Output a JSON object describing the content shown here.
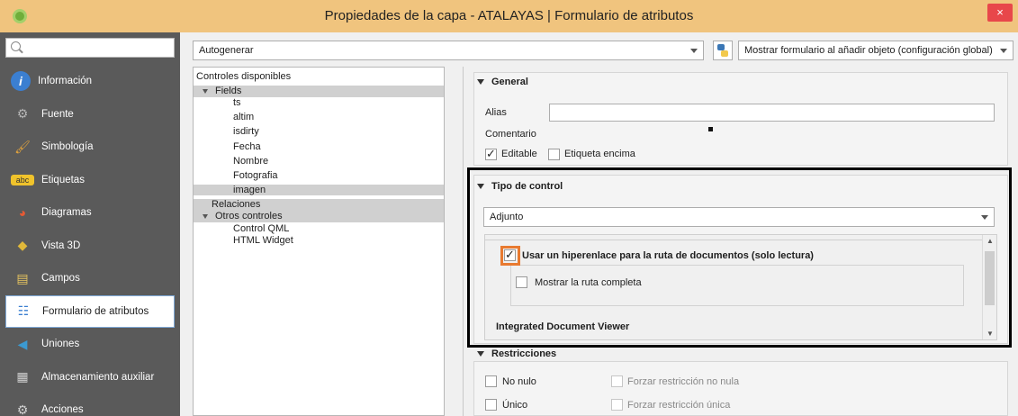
{
  "window": {
    "title": "Propiedades de la capa - ATALAYAS | Formulario de atributos",
    "close_label": "×"
  },
  "sidebar": {
    "search_placeholder": "",
    "items": [
      {
        "label": "Información",
        "icon": "info-icon",
        "icon_char": "i",
        "icon_color": "#3b7fd1"
      },
      {
        "label": "Fuente",
        "icon": "source-icon",
        "icon_char": "⚙",
        "icon_color": "#b5b5b5"
      },
      {
        "label": "Simbología",
        "icon": "symbology-icon",
        "icon_char": "🖌",
        "icon_color": "#e2a33c"
      },
      {
        "label": "Etiquetas",
        "icon": "labels-icon",
        "icon_char": "abc",
        "icon_color": "#f0c32b"
      },
      {
        "label": "Diagramas",
        "icon": "diagrams-icon",
        "icon_char": "◕",
        "icon_color": "#e55a34"
      },
      {
        "label": "Vista 3D",
        "icon": "3d-view-icon",
        "icon_char": "◆",
        "icon_color": "#e0b83a"
      },
      {
        "label": "Campos",
        "icon": "fields-icon",
        "icon_char": "▤",
        "icon_color": "#e6c45f"
      },
      {
        "label": "Formulario de atributos",
        "icon": "attributes-form-icon",
        "icon_char": "☷",
        "icon_color": "#3b7fd1"
      },
      {
        "label": "Uniones",
        "icon": "joins-icon",
        "icon_char": "◀",
        "icon_color": "#3b9ad1"
      },
      {
        "label": "Almacenamiento auxiliar",
        "icon": "auxiliary-storage-icon",
        "icon_char": "▦",
        "icon_color": "#d0d0d0"
      },
      {
        "label": "Acciones",
        "icon": "actions-icon",
        "icon_char": "⚙",
        "icon_color": "#d0d0d0"
      }
    ],
    "active_index": 7
  },
  "toolbar": {
    "layout_mode": "Autogenerar",
    "form_suppress": "Mostrar formulario al añadir objeto (configuración global)"
  },
  "tree": {
    "header": "Controles disponibles",
    "fields_label": "Fields",
    "fields": [
      "ts",
      "altim",
      "isdirty",
      "Fecha",
      "Nombre",
      "Fotografia",
      "imagen"
    ],
    "relations_label": "Relaciones",
    "other_label": "Otros controles",
    "other": [
      "Control QML",
      "HTML Widget"
    ]
  },
  "general": {
    "title": "General",
    "alias_label": "Alias",
    "alias_value": "",
    "comment_label": "Comentario",
    "editable_label": "Editable",
    "editable_checked": true,
    "label_on_top_label": "Etiqueta encima",
    "label_on_top_checked": false
  },
  "widget_type": {
    "title": "Tipo de control",
    "selected": "Adjunto",
    "hyperlink_label": "Usar un hiperenlace para la ruta de documentos (solo lectura)",
    "hyperlink_checked": true,
    "full_path_label": "Mostrar la ruta completa",
    "full_path_checked": false,
    "integrated_viewer_label": "Integrated Document Viewer"
  },
  "constraints": {
    "title": "Restricciones",
    "not_null_label": "No nulo",
    "enforce_not_null_label": "Forzar restricción no nula",
    "unique_label": "Único",
    "enforce_unique_label": "Forzar restricción única"
  },
  "colors": {
    "titlebar": "#f0c47e",
    "sidebar": "#5a5a5a",
    "highlight_frame": "#000000",
    "orange_highlight": "#e87a30"
  }
}
